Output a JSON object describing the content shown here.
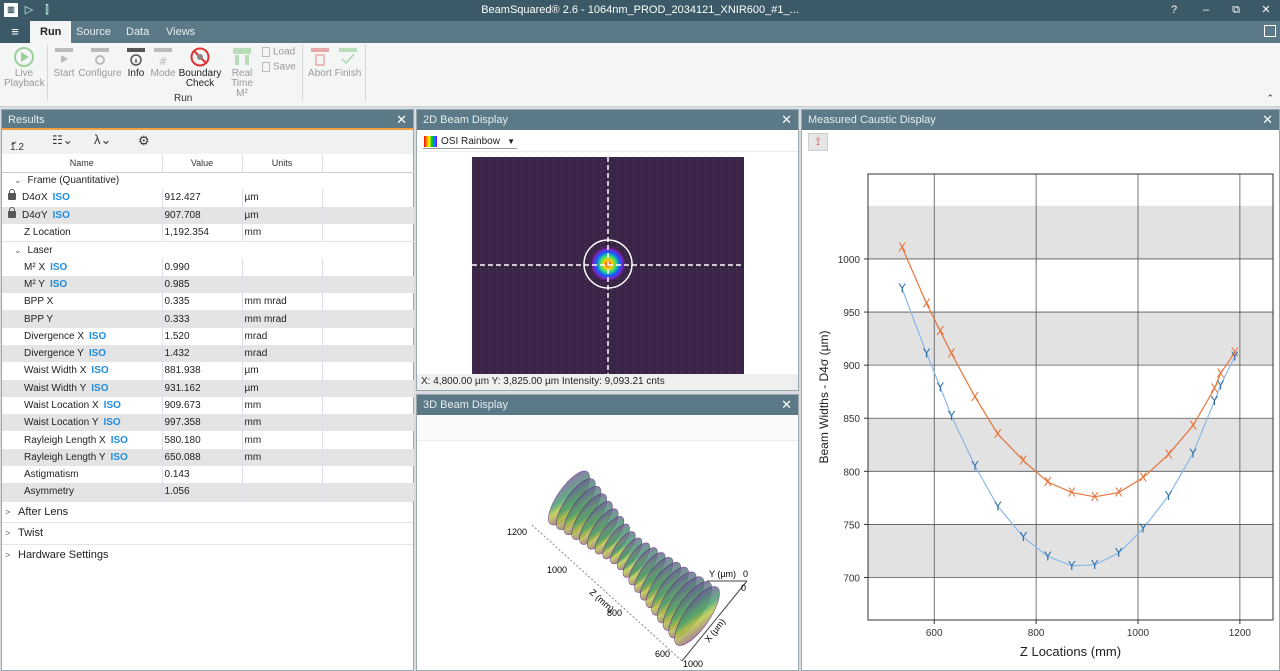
{
  "window": {
    "title": "BeamSquared® 2.6 - 1064nm_PROD_2034121_XNIR600_#1_...",
    "help_icon": "?",
    "min_icon": "–",
    "max_icon": "⧉",
    "close_icon": "✕"
  },
  "menu": {
    "tabs": [
      {
        "label": "Run"
      },
      {
        "label": "Source"
      },
      {
        "label": "Data"
      },
      {
        "label": "Views"
      }
    ]
  },
  "ribbon": {
    "buttons": {
      "live_playback": "Live\nPlayback",
      "start": "Start",
      "configure": "Configure",
      "info": "Info",
      "mode": "Mode",
      "boundary_check": "Boundary\nCheck",
      "real_time": "Real\nTime M²",
      "load": "Load",
      "save": "Save",
      "abort": "Abort",
      "finish": "Finish"
    },
    "group_label": "Run"
  },
  "results": {
    "title": "Results",
    "precision": "1.2",
    "columns": [
      "Name",
      "Value",
      "Units"
    ],
    "frame_group": "Frame (Quantitative)",
    "frame_rows": [
      {
        "name": "D4σX",
        "iso": "ISO",
        "value": "912.427",
        "units": "µm"
      },
      {
        "name": "D4σY",
        "iso": "ISO",
        "value": "907.708",
        "units": "µm"
      },
      {
        "name": "Z Location",
        "iso": "",
        "value": "1,192.354",
        "units": "mm"
      }
    ],
    "laser_group": "Laser",
    "laser_rows": [
      {
        "name": "M² X",
        "iso": "ISO",
        "value": "0.990",
        "units": ""
      },
      {
        "name": "M² Y",
        "iso": "ISO",
        "value": "0.985",
        "units": ""
      },
      {
        "name": "BPP X",
        "iso": "",
        "value": "0.335",
        "units": "mm mrad"
      },
      {
        "name": "BPP Y",
        "iso": "",
        "value": "0.333",
        "units": "mm mrad"
      },
      {
        "name": "Divergence X",
        "iso": "ISO",
        "value": "1.520",
        "units": "mrad"
      },
      {
        "name": "Divergence Y",
        "iso": "ISO",
        "value": "1.432",
        "units": "mrad"
      },
      {
        "name": "Waist Width X",
        "iso": "ISO",
        "value": "881.938",
        "units": "µm"
      },
      {
        "name": "Waist Width Y",
        "iso": "ISO",
        "value": "931.162",
        "units": "µm"
      },
      {
        "name": "Waist Location X",
        "iso": "ISO",
        "value": "909.673",
        "units": "mm"
      },
      {
        "name": "Waist Location Y",
        "iso": "ISO",
        "value": "997.358",
        "units": "mm"
      },
      {
        "name": "Rayleigh Length X",
        "iso": "ISO",
        "value": "580.180",
        "units": "mm"
      },
      {
        "name": "Rayleigh Length Y",
        "iso": "ISO",
        "value": "650.088",
        "units": "mm"
      },
      {
        "name": "Astigmatism",
        "iso": "",
        "value": "0.143",
        "units": ""
      },
      {
        "name": "Asymmetry",
        "iso": "",
        "value": "1.056",
        "units": ""
      }
    ],
    "collapsed_groups": [
      "After Lens",
      "Twist",
      "Hardware Settings"
    ]
  },
  "beam2d": {
    "title": "2D Beam Display",
    "palette": "OSI Rainbow",
    "readout": "X: 4,800.00 µm  Y: 3,825.00 µm  Intensity: 9,093.21 cnts"
  },
  "beam3d": {
    "title": "3D Beam Display",
    "z_axis_label": "Z (mm)",
    "y_axis_label": "Y (µm)",
    "x_axis_label": "X (µm)",
    "z_ticks": [
      "1200",
      "1000",
      "800",
      "600"
    ],
    "y_tick": "0",
    "x_ticks": [
      "0",
      "1000"
    ]
  },
  "caustic": {
    "title": "Measured Caustic Display",
    "x_marker": "X",
    "y_marker": "Y"
  },
  "chart_data": {
    "type": "scatter",
    "xlabel": "Z Locations (mm)",
    "ylabel": "Beam Widths - D4σ (µm)",
    "xlim": [
      470,
      1265
    ],
    "ylim": [
      660,
      1080
    ],
    "xticks": [
      600,
      800,
      1000,
      1200
    ],
    "yticks": [
      700,
      750,
      800,
      850,
      900,
      950,
      1000
    ],
    "colors": {
      "X": "#e8743b",
      "Y": "#2f6fa6",
      "fitY": "#8ab8e8"
    },
    "series": [
      {
        "name": "X",
        "x": [
          537,
          585,
          612,
          634,
          680,
          725,
          775,
          823,
          870,
          915,
          962,
          1010,
          1060,
          1108,
          1150,
          1162,
          1190
        ],
        "y": [
          1011,
          958,
          932,
          911,
          870,
          835,
          810,
          790,
          780,
          776,
          780,
          794,
          816,
          843,
          878,
          892,
          912
        ]
      },
      {
        "name": "Y",
        "x": [
          537,
          585,
          612,
          634,
          680,
          725,
          775,
          823,
          870,
          915,
          962,
          1010,
          1060,
          1108,
          1150,
          1162,
          1190
        ],
        "y": [
          972,
          911,
          879,
          852,
          805,
          767,
          738,
          720,
          711,
          712,
          723,
          746,
          777,
          817,
          866,
          881,
          908
        ]
      }
    ]
  }
}
